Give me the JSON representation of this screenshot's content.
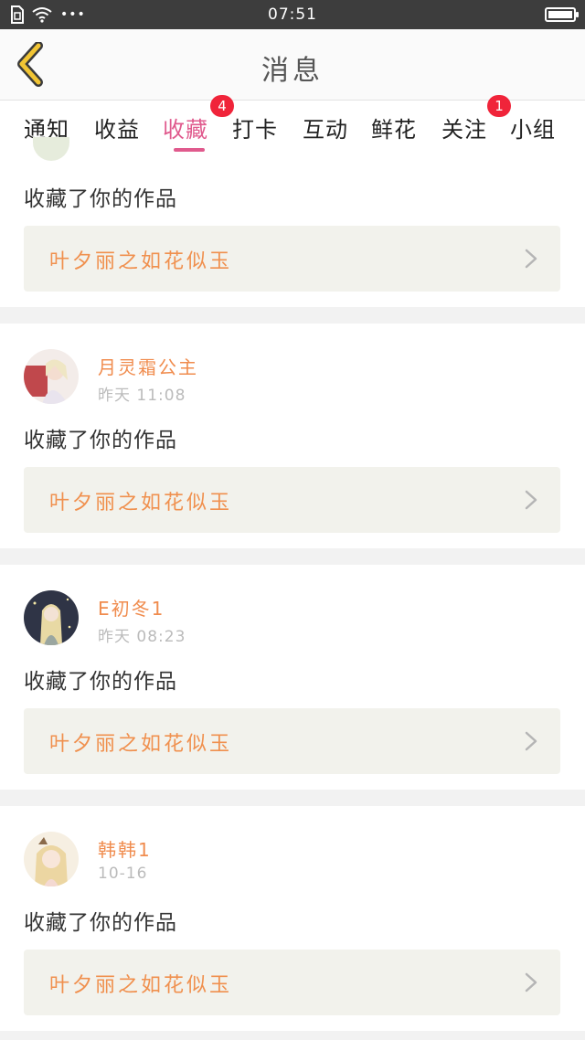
{
  "status_bar": {
    "time": "07:51",
    "dots": "•••"
  },
  "header": {
    "title": "消息"
  },
  "tabs": [
    {
      "label": "通知"
    },
    {
      "label": "收益"
    },
    {
      "label": "收藏",
      "badge": "4",
      "active": true
    },
    {
      "label": "打卡"
    },
    {
      "label": "互动"
    },
    {
      "label": "鲜花"
    },
    {
      "label": "关注",
      "badge": "1"
    },
    {
      "label": "小组"
    }
  ],
  "cards": [
    {
      "action": "收藏了你的作品",
      "work_title": "叶夕丽之如花似玉"
    },
    {
      "username": "月灵霜公主",
      "time": "昨天 11:08",
      "action": "收藏了你的作品",
      "work_title": "叶夕丽之如花似玉"
    },
    {
      "username": "E初冬1",
      "time": "昨天 08:23",
      "action": "收藏了你的作品",
      "work_title": "叶夕丽之如花似玉"
    },
    {
      "username": "韩韩1",
      "time": "10-16",
      "action": "收藏了你的作品",
      "work_title": "叶夕丽之如花似玉"
    }
  ],
  "colors": {
    "accent": "#e05a8d",
    "username": "#f08c4e",
    "badge": "#f0243a",
    "back_arrow": "#f2c534"
  }
}
